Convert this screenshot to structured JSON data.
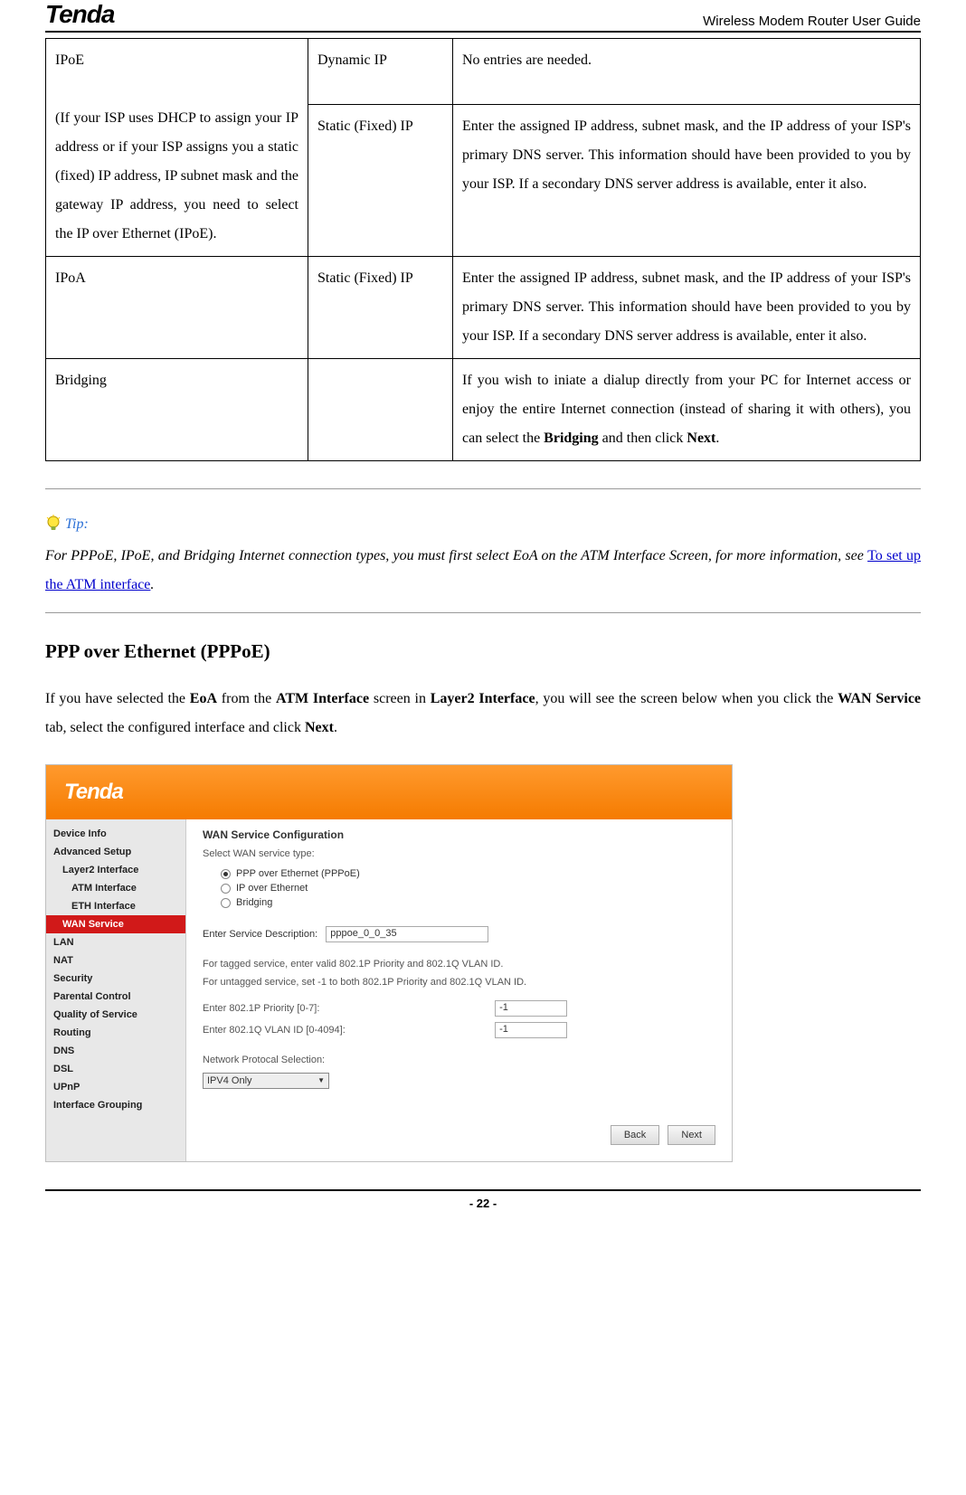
{
  "header": {
    "brand": "Tenda",
    "doc_title": "Wireless Modem Router User Guide"
  },
  "table": {
    "ipoe": {
      "title": "IPoE",
      "desc": "(If your ISP uses DHCP to assign your IP address or if your ISP assigns you a static (fixed) IP address, IP subnet mask and the gateway IP address, you need to select the IP over Ethernet (IPoE).",
      "dynamic_label": "Dynamic IP",
      "dynamic_desc": "No entries are needed.",
      "static_label": "Static (Fixed) IP",
      "static_desc": "Enter the assigned IP address, subnet mask, and the IP address of your ISP's primary DNS server. This information should have been provided to you by your ISP. If a secondary DNS server address is available, enter it also."
    },
    "ipoa": {
      "title": "IPoA",
      "static_label": "Static (Fixed) IP",
      "static_desc": "Enter the assigned IP address, subnet mask, and the IP address of your ISP's primary DNS server. This information should have been provided to you by your ISP. If a secondary DNS server address is available, enter it also."
    },
    "bridging": {
      "title": "Bridging",
      "desc_prefix": "If you wish to iniate a dialup directly from your PC for Internet access or enjoy the entire Internet connection (instead of sharing it with others), you can select the ",
      "bold1": "Bridging",
      "mid": " and then click ",
      "bold2": "Next",
      "suffix": "."
    }
  },
  "tip": {
    "label": "Tip:",
    "body_prefix": "For PPPoE, IPoE, and Bridging Internet connection types, you must first select EoA on the ATM Interface Screen, for more information, see ",
    "link": "To set up the ATM interface",
    "body_suffix": "."
  },
  "section": {
    "heading": "PPP over Ethernet (PPPoE)",
    "para_p1": "If you have selected the ",
    "para_b1": "EoA",
    "para_p2": " from the ",
    "para_b2": "ATM Interface",
    "para_p3": " screen in ",
    "para_b3": "Layer2 Interface",
    "para_p4": ", you will see the screen below when you click the ",
    "para_b4": "WAN Service",
    "para_p5": " tab, select the configured interface and click ",
    "para_b5": "Next",
    "para_p6": "."
  },
  "screenshot": {
    "logo": "Tenda",
    "nav": {
      "device_info": "Device Info",
      "advanced": "Advanced Setup",
      "layer2": "Layer2 Interface",
      "atm": "ATM Interface",
      "eth": "ETH Interface",
      "wan": "WAN Service",
      "lan": "LAN",
      "nat": "NAT",
      "security": "Security",
      "parental": "Parental Control",
      "qos": "Quality of Service",
      "routing": "Routing",
      "dns": "DNS",
      "dsl": "DSL",
      "upnp": "UPnP",
      "ifg": "Interface Grouping"
    },
    "content": {
      "title": "WAN Service Configuration",
      "select_type": "Select WAN service type:",
      "r1": "PPP over Ethernet (PPPoE)",
      "r2": "IP over Ethernet",
      "r3": "Bridging",
      "svc_desc_label": "Enter Service Description:",
      "svc_desc_value": "pppoe_0_0_35",
      "tag_note1": "For tagged service, enter valid 802.1P Priority and 802.1Q VLAN ID.",
      "tag_note2": "For untagged service, set -1 to both 802.1P Priority and 802.1Q VLAN ID.",
      "p8021p_label": "Enter 802.1P Priority [0-7]:",
      "p8021p_value": "-1",
      "vlan_label": "Enter 802.1Q VLAN ID [0-4094]:",
      "vlan_value": "-1",
      "net_proto_label": "Network Protocal Selection:",
      "net_proto_value": "IPV4 Only",
      "back": "Back",
      "next": "Next"
    }
  },
  "page_number": "- 22 -"
}
